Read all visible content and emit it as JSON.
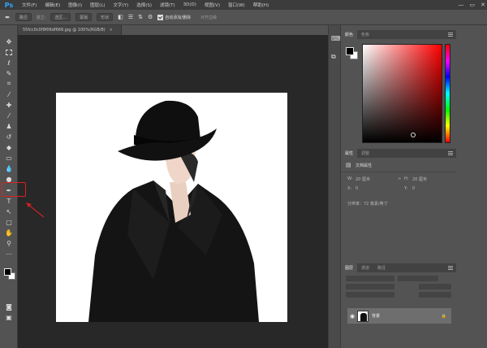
{
  "app": {
    "logo": "Ps"
  },
  "menu": [
    "文件(F)",
    "编辑(E)",
    "图像(I)",
    "图层(L)",
    "文字(Y)",
    "选择(S)",
    "滤镜(T)",
    "3D(D)",
    "视图(V)",
    "窗口(W)",
    "帮助(H)"
  ],
  "window_controls": {
    "minimize": "—",
    "restore": "▭",
    "close": "✕"
  },
  "options_bar": {
    "tool_mode": "路径",
    "make_label": "建立:",
    "select_label": "选区...",
    "mask_label": "蒙版",
    "shape_label": "形状",
    "auto_add_delete": "自动添加/删除",
    "align_edges": "对齐边缘"
  },
  "document_tab": {
    "title": "55fcc0c0f9f06df666.jpg @ 100%(RGB/8)",
    "close": "×"
  },
  "color_panel": {
    "tabs": [
      "颜色",
      "色板"
    ],
    "active": 0,
    "hue_color": "#ff0000"
  },
  "properties_panel": {
    "tabs": [
      "属性",
      "调整"
    ],
    "header": "文档属性",
    "w_label": "W:",
    "w_value": "20 厘米",
    "h_label": "H:",
    "h_value": "20 厘米",
    "x_label": "X:",
    "x_value": "0",
    "y_label": "Y:",
    "y_value": "0",
    "resolution": "分辨率：72 像素/英寸"
  },
  "layers_panel": {
    "tabs": [
      "图层",
      "通道",
      "路径"
    ],
    "layer_name": "背景"
  },
  "annotation": {
    "highlight_color": "#e02020"
  }
}
